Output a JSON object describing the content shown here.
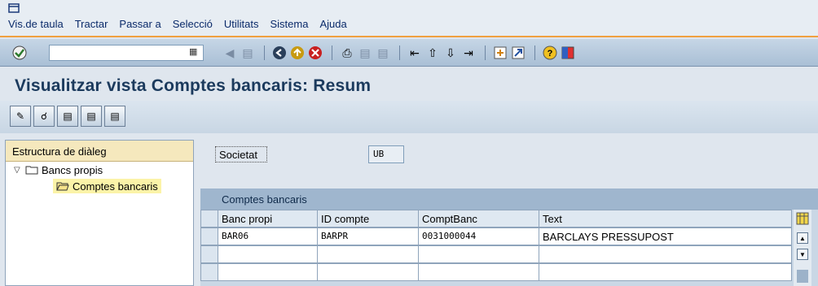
{
  "menu": {
    "items": [
      "Vis.de taula",
      "Tractar",
      "Passar a",
      "Selecció",
      "Utilitats",
      "Sistema",
      "Ajuda"
    ]
  },
  "toolbar": {
    "icons": [
      "enter-icon",
      "back-icon",
      "save-icon",
      "back-nav-icon",
      "exit-icon",
      "cancel-icon",
      "print-icon",
      "find-icon",
      "find-next-icon",
      "first-page-icon",
      "previous-page-icon",
      "next-page-icon",
      "last-page-icon",
      "create-session-icon",
      "shortcut-icon",
      "help-icon",
      "customize-layout-icon"
    ]
  },
  "page": {
    "title": "Visualitzar vista Comptes bancaris: Resum"
  },
  "app_toolbar": {
    "icons": [
      "display-change-icon",
      "detail-icon",
      "select-all-icon",
      "select-block-icon",
      "deselect-all-icon"
    ]
  },
  "tree": {
    "header": "Estructura de diàleg",
    "root": "Bancs propis",
    "child": "Comptes bancaris"
  },
  "filter": {
    "society_label": "Societat",
    "society_value": "UB"
  },
  "grid": {
    "title": "Comptes bancaris",
    "columns": [
      "Banc propi",
      "ID compte",
      "ComptBanc",
      "Text"
    ],
    "rows": [
      [
        "BAR06",
        "BARPR",
        "0031000044",
        "BARCLAYS PRESSUPOST"
      ]
    ]
  },
  "colors": {
    "title": "#1b3a5d",
    "accent_line": "#f0a040",
    "tree_header": "#f5e8bd",
    "selection": "#fbf3a8"
  }
}
